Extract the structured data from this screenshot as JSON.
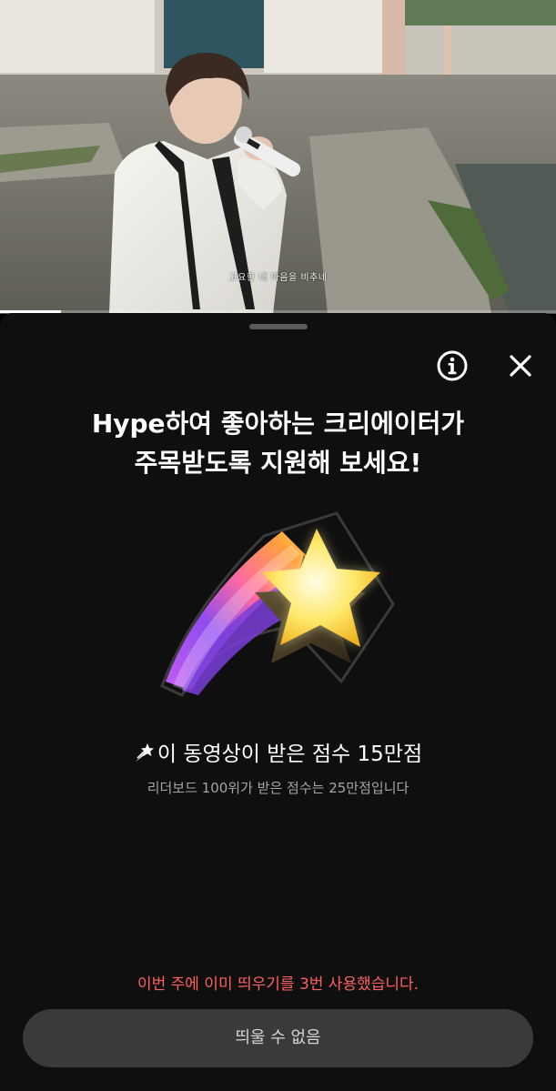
{
  "video": {
    "subtitle": "고요한 내 마음을 비추네",
    "progress": 0.11
  },
  "sheet": {
    "info_icon": "info-icon",
    "close_icon": "close-icon",
    "headline_line1": "Hype하여 좋아하는 크리에이터가",
    "headline_line2": "주목받도록 지원해 보세요!",
    "art": "shooting-star-illustration",
    "score_icon": "shooting-star-emoji-icon",
    "score_text": "이 동영상이 받은 점수 15만점",
    "leaderboard_text": "리더보드 100위가 받은 점수는 25만점입니다",
    "warning_text": "이번 주에 이미 띄우기를 3번 사용했습니다.",
    "button_label": "띄울 수 없음"
  },
  "colors": {
    "sheet_background": "#0f0f0f",
    "warning": "#ff6060",
    "button_background": "#3a3a3a",
    "button_text": "#d4d4d4"
  }
}
